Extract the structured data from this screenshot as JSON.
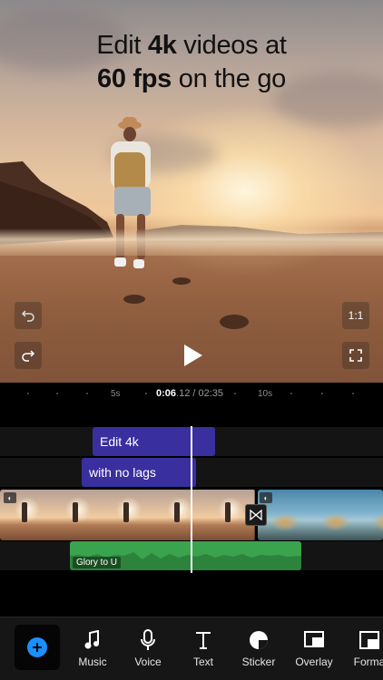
{
  "preview": {
    "headline_line1_pre": "Edit ",
    "headline_line1_bold": "4k",
    "headline_line1_post": " videos at",
    "headline_line2_bold": "60 fps",
    "headline_line2_post": " on the go",
    "aspect_label": "1:1"
  },
  "ruler": {
    "tick_5s": "5s",
    "tick_10s": "10s",
    "current_time": "0:06",
    "current_frac": ".12 / 02:35"
  },
  "timeline": {
    "text_clip_1": "Edit 4k",
    "text_clip_2": "with no lags",
    "audio_clip_label": "Glory to U"
  },
  "toolbar": {
    "music": "Music",
    "voice": "Voice",
    "text": "Text",
    "sticker": "Sticker",
    "overlay": "Overlay",
    "format": "Forma"
  },
  "colors": {
    "accent_blue": "#1a90ff",
    "text_clip": "#3a2f9e",
    "audio_clip": "#3aa34e"
  }
}
